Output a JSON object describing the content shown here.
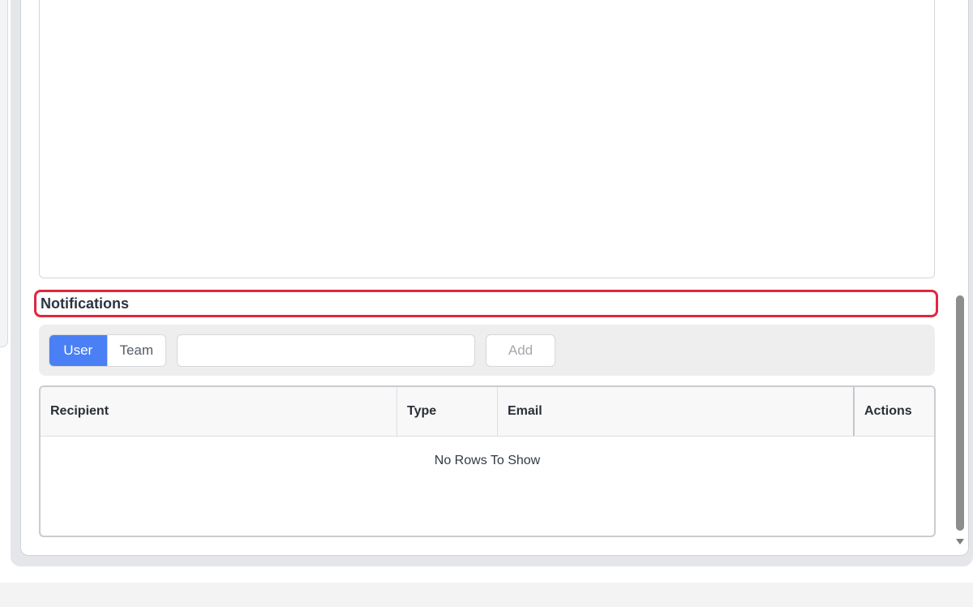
{
  "notifications": {
    "heading": "Notifications"
  },
  "toolbar": {
    "segments": {
      "user": "User",
      "team": "Team",
      "active": "User"
    },
    "recipient_input": {
      "value": "",
      "placeholder": ""
    },
    "add_label": "Add",
    "accent_color": "#4a7ff5"
  },
  "table": {
    "columns": [
      "Recipient",
      "Type",
      "Email",
      "Actions"
    ],
    "rows": [],
    "empty_message": "No Rows To Show"
  },
  "highlight_color": "#e0283e"
}
